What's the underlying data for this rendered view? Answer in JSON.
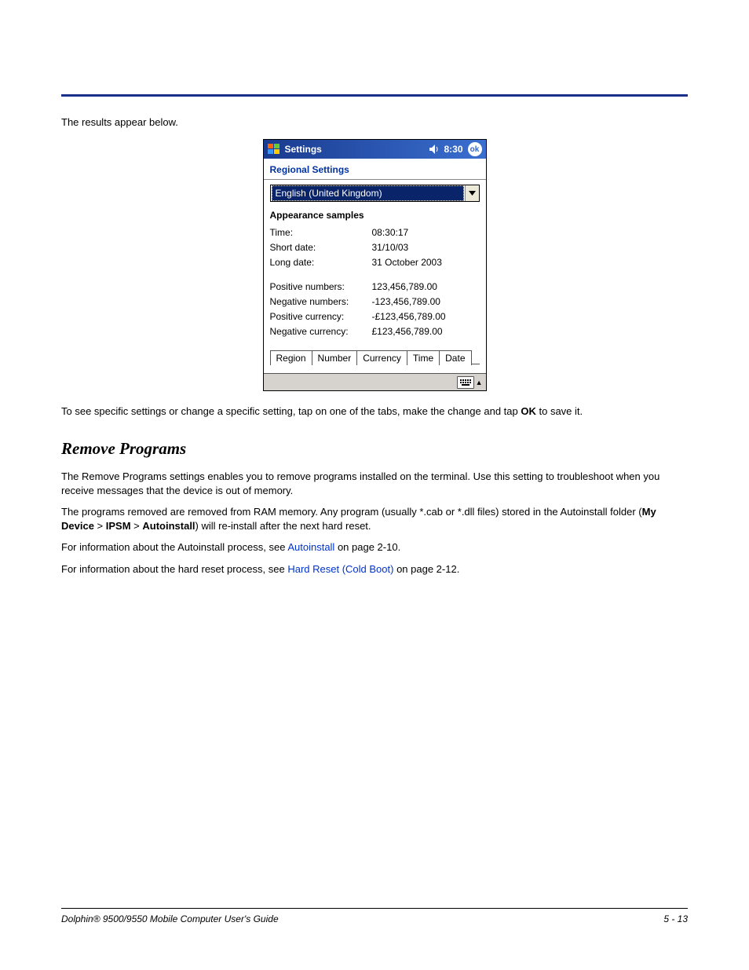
{
  "intro": "The results appear below.",
  "screenshot": {
    "title": "Settings",
    "clock": "8:30",
    "ok": "ok",
    "section": "Regional Settings",
    "combo": "English (United Kingdom)",
    "samples_heading": "Appearance samples",
    "rows1": [
      {
        "lbl": "Time:",
        "val": "08:30:17"
      },
      {
        "lbl": "Short date:",
        "val": "31/10/03"
      },
      {
        "lbl": "Long date:",
        "val": "31 October 2003"
      }
    ],
    "rows2": [
      {
        "lbl": "Positive numbers:",
        "val": "123,456,789.00"
      },
      {
        "lbl": "Negative numbers:",
        "val": "-123,456,789.00"
      },
      {
        "lbl": "Positive currency:",
        "val": "-£123,456,789.00"
      },
      {
        "lbl": "Negative currency:",
        "val": "£123,456,789.00"
      }
    ],
    "tabs": [
      "Region",
      "Number",
      "Currency",
      "Time",
      "Date"
    ]
  },
  "caption": {
    "pre": "To see specific settings or change a specific setting, tap on one of the tabs, make the change and tap ",
    "bold": "OK",
    "post": " to save it."
  },
  "h2": "Remove Programs",
  "p1": "The Remove Programs settings enables you to remove programs installed on the terminal. Use this setting to troubleshoot when you receive messages that the device is out of memory.",
  "p2": {
    "pre": "The programs removed are removed from RAM memory. Any program (usually *.cab or *.dll files) stored in the Autoinstall folder (",
    "b1": "My Device",
    "gt1": " > ",
    "b2": "IPSM",
    "gt2": " > ",
    "b3": "Autoinstall",
    "post": ") will re-install after the next hard reset."
  },
  "p3": {
    "pre": "For information about the Autoinstall process, see ",
    "link": "Autoinstall",
    "post": " on page 2-10."
  },
  "p4": {
    "pre": "For information about the hard reset process, see ",
    "link": "Hard Reset (Cold Boot)",
    "post": " on page 2-12."
  },
  "footer": {
    "left": "Dolphin® 9500/9550 Mobile Computer User's Guide",
    "right": "5 - 13"
  }
}
